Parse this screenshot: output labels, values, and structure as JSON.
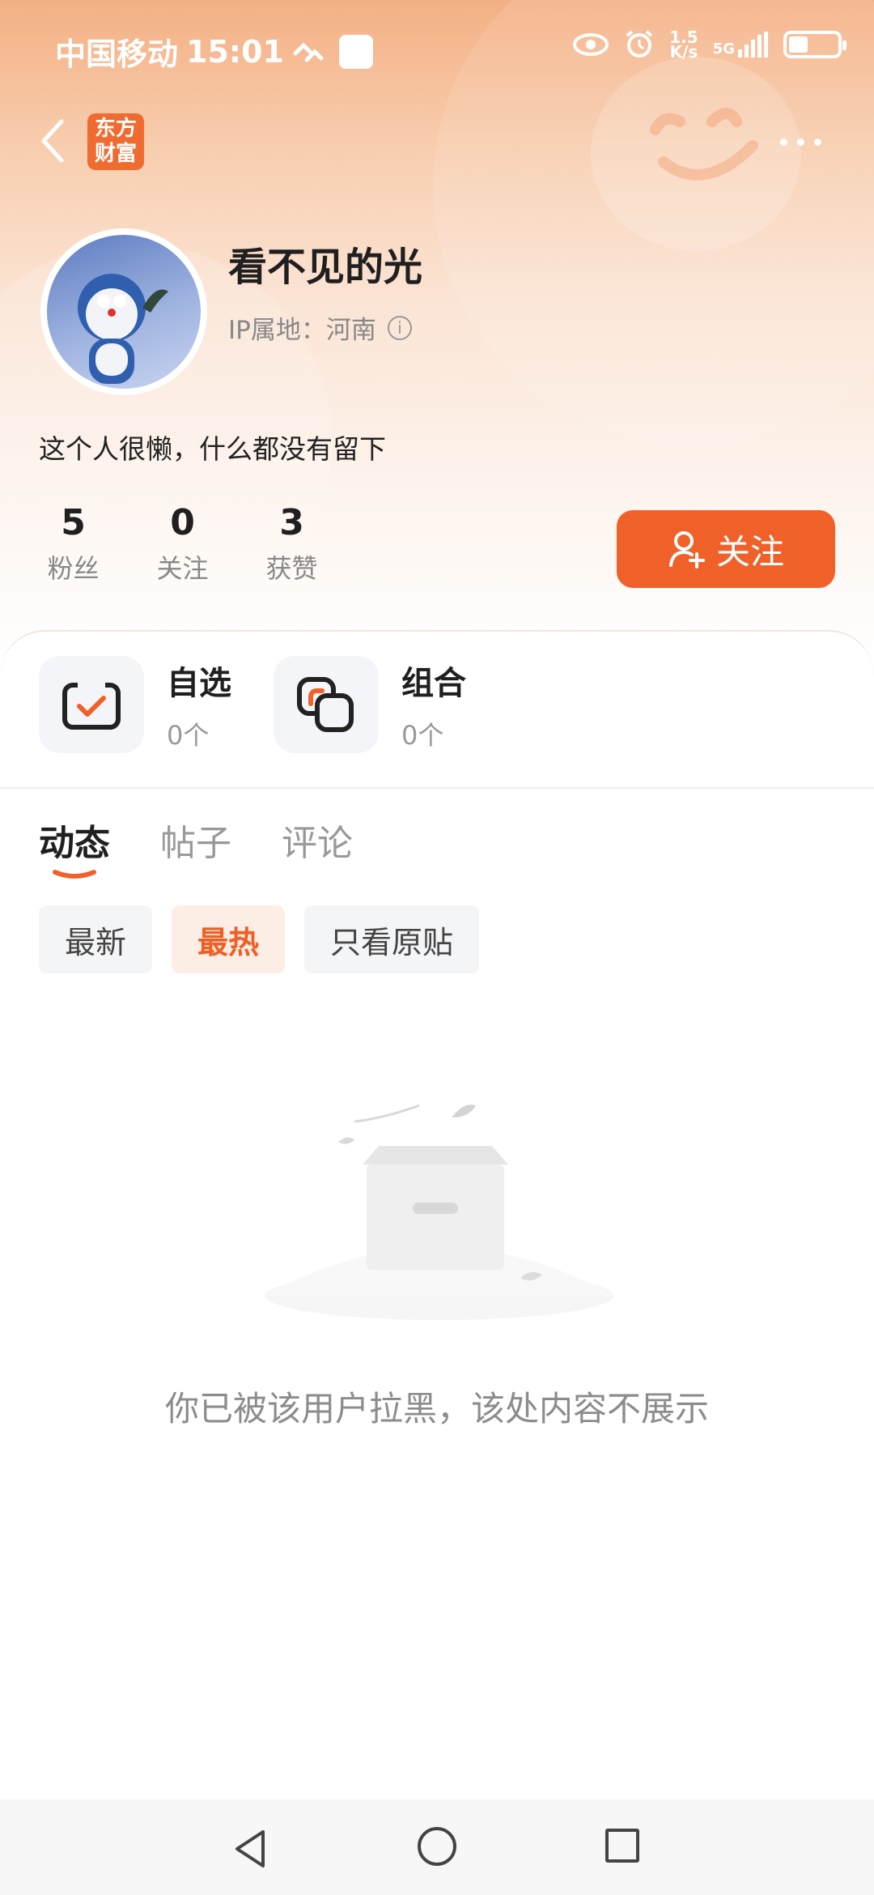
{
  "status_bar": {
    "carrier": "中国移动",
    "time": "15:01",
    "net_speed_top": "1.5",
    "net_speed_bottom": "K/s",
    "network": "5G",
    "battery_level_percent": 40
  },
  "header": {
    "logo_line1": "东方",
    "logo_line2": "财富"
  },
  "profile": {
    "username": "看不见的光",
    "ip_label": "IP属地：河南",
    "bio": "这个人很懒，什么都没有留下",
    "stats": [
      {
        "value": "5",
        "label": "粉丝"
      },
      {
        "value": "0",
        "label": "关注"
      },
      {
        "value": "3",
        "label": "获赞"
      }
    ],
    "follow_label": "关注"
  },
  "portfolio": [
    {
      "title": "自选",
      "count": "0个",
      "icon": "checkbox-icon"
    },
    {
      "title": "组合",
      "count": "0个",
      "icon": "layers-icon"
    }
  ],
  "tabs": [
    {
      "label": "动态",
      "active": true
    },
    {
      "label": "帖子",
      "active": false
    },
    {
      "label": "评论",
      "active": false
    }
  ],
  "filters": [
    {
      "label": "最新",
      "active": false
    },
    {
      "label": "最热",
      "active": true
    },
    {
      "label": "只看原贴",
      "active": false
    }
  ],
  "empty_message": "你已被该用户拉黑，该处内容不展示",
  "colors": {
    "accent": "#f06129",
    "header_gradient_top": "#f4b084",
    "text_primary": "#1f1f1f",
    "text_secondary": "#888888"
  }
}
